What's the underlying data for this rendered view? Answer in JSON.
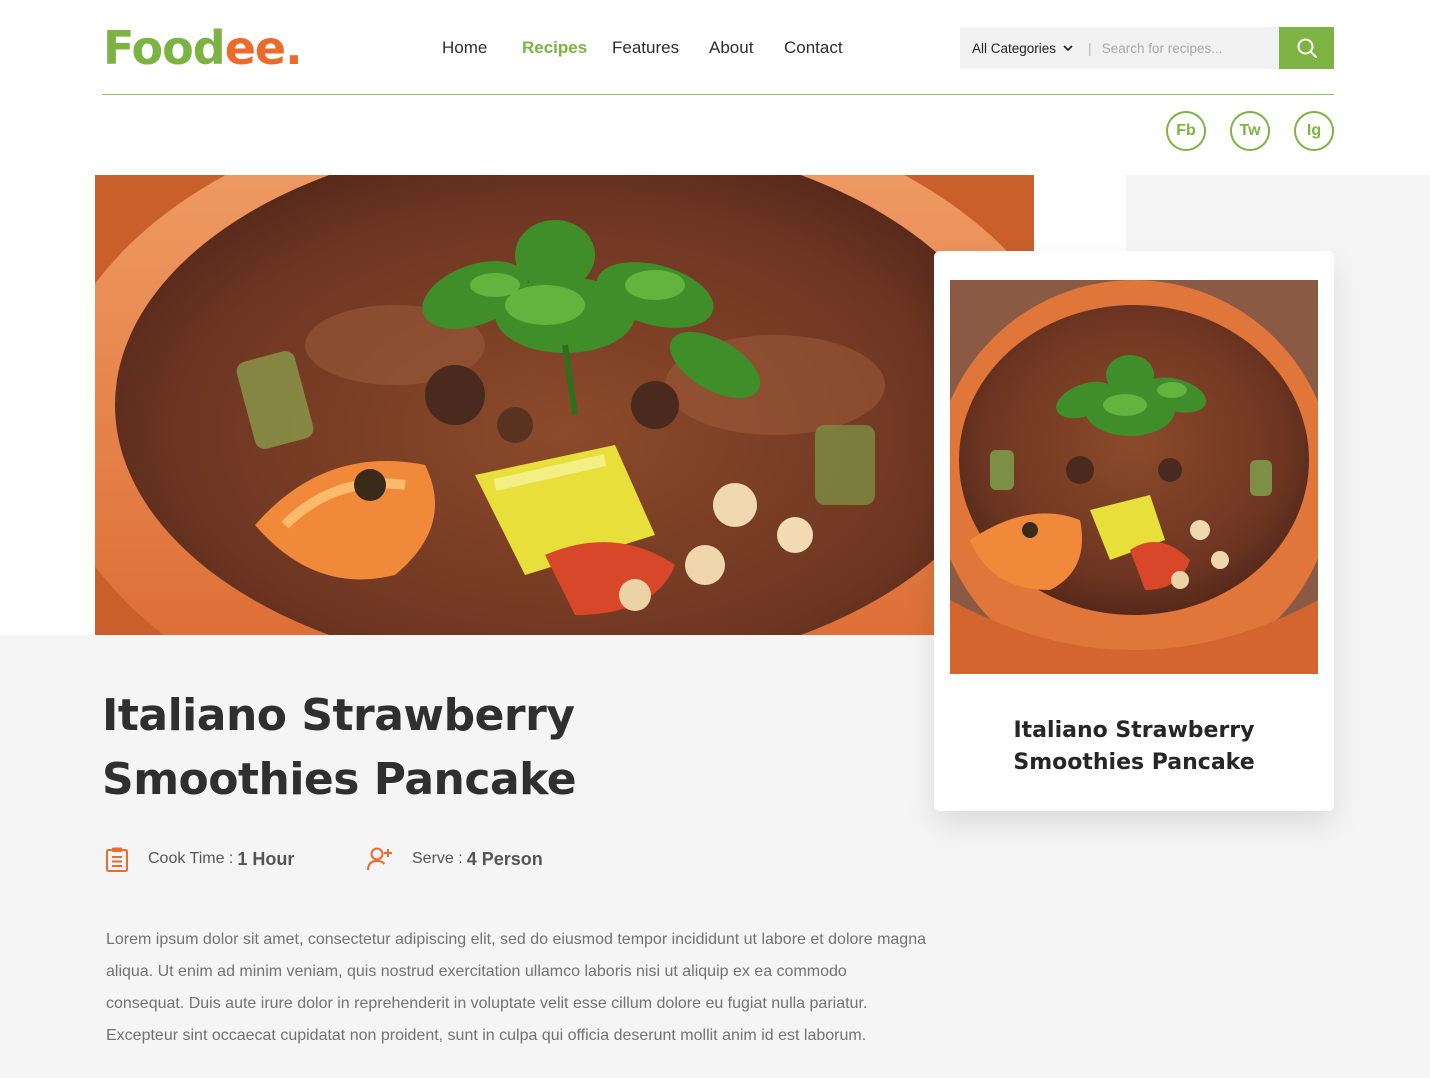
{
  "brand": {
    "logo_part1": "Food",
    "logo_part2": "ee."
  },
  "nav": {
    "items": [
      {
        "label": "Home",
        "active": false
      },
      {
        "label": "Recipes",
        "active": true
      },
      {
        "label": "Features",
        "active": false
      },
      {
        "label": "About",
        "active": false
      },
      {
        "label": "Contact",
        "active": false
      }
    ]
  },
  "search": {
    "category_label": "All Categories",
    "separator": "|",
    "placeholder": "Search for recipes...",
    "value": ""
  },
  "social": {
    "facebook": "Fb",
    "twitter": "Tw",
    "instagram": "Ig"
  },
  "recipe": {
    "title": "Italiano Strawberry Smoothies Pancake",
    "cook_time_label": "Cook Time :",
    "cook_time_value": "1 Hour",
    "serve_label": "Serve :",
    "serve_value": "4 Person",
    "description": "Lorem ipsum dolor sit amet, consectetur adipiscing elit, sed do eiusmod tempor incididunt ut labore et dolore magna aliqua. Ut enim ad minim veniam, quis nostrud exercitation ullamco laboris nisi ut aliquip ex ea commodo consequat. Duis aute irure dolor in reprehenderit in voluptate velit esse cillum dolore eu fugiat nulla pariatur. Excepteur sint occaecat cupidatat non proident, sunt in culpa qui officia deserunt mollit anim id est laborum."
  },
  "card": {
    "title": "Italiano Strawberry Smoothies Pancake"
  },
  "colors": {
    "accent": "#7cb342",
    "orange": "#ec6a2c",
    "text": "#2f2f2f",
    "muted": "#727272",
    "panel": "#f5f5f5"
  },
  "icons": {
    "search": "search-icon",
    "chevron": "chevron-down-icon",
    "cook": "clipboard-icon",
    "serve": "user-plus-icon"
  }
}
